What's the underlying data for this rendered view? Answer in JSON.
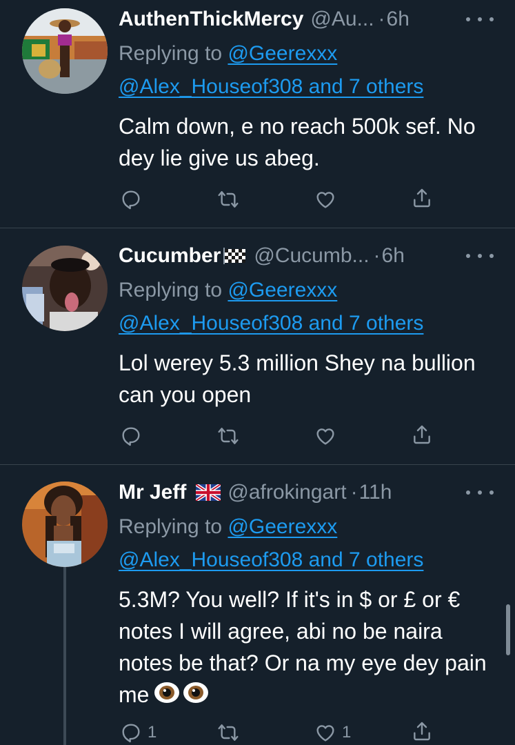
{
  "tweets": [
    {
      "name": "AuthenThickMercy",
      "handle": "@Au...",
      "separator": "·",
      "time": "6h",
      "replying_prefix": "Replying to",
      "replying_user": "@Geerexxx",
      "replying_others": "@Alex_Houseof308 and 7 others",
      "text": "Calm down, e no reach 500k sef. No dey lie give us abeg.",
      "reply_count": "",
      "retweet_count": "",
      "like_count": "",
      "flag": ""
    },
    {
      "name": "Cucumber",
      "handle": "@Cucumb...",
      "separator": "·",
      "time": "6h",
      "replying_prefix": "Replying to",
      "replying_user": "@Geerexxx",
      "replying_others": "@Alex_Houseof308 and 7 others",
      "text": "Lol werey 5.3 million Shey na bullion can you open",
      "reply_count": "",
      "retweet_count": "",
      "like_count": "",
      "flag": "chequered-flag"
    },
    {
      "name": "Mr Jeff",
      "handle": "@afrokingart",
      "separator": "·",
      "time": "11h",
      "replying_prefix": "Replying to",
      "replying_user": "@Geerexxx",
      "replying_others": "@Alex_Houseof308 and 7 others",
      "text": "5.3M? You well? If it's in $ or £ or € notes I will agree, abi no be naira notes be that? Or na my eye dey pain me",
      "emoji": "eyes-emoji",
      "reply_count": "1",
      "retweet_count": "",
      "like_count": "1",
      "flag": "uk-flag"
    }
  ],
  "colors": {
    "background": "#15202b",
    "divider": "#38444d",
    "secondary_text": "#8b98a5",
    "link": "#1d9bf0",
    "primary_text": "#ffffff"
  },
  "icons": [
    "reply-icon",
    "retweet-icon",
    "like-icon",
    "share-icon",
    "more-icon"
  ]
}
